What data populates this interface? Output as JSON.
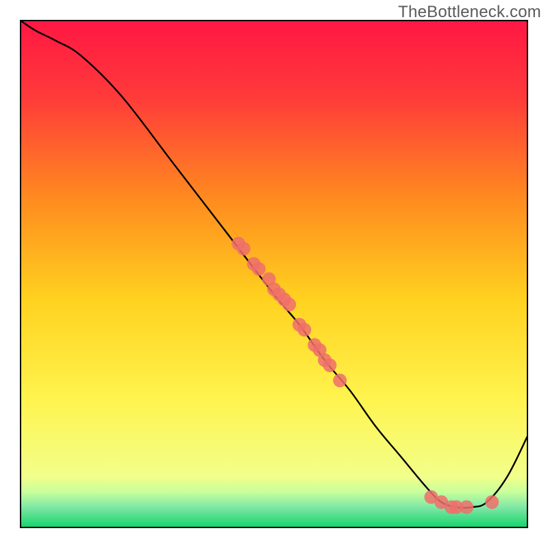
{
  "attribution": "TheBottleneck.com",
  "chart_data": {
    "type": "line",
    "title": "",
    "xlabel": "",
    "ylabel": "",
    "xlim": [
      0,
      100
    ],
    "ylim": [
      0,
      100
    ],
    "series": [
      {
        "name": "curve",
        "x": [
          0,
          3,
          7,
          12,
          20,
          30,
          40,
          50,
          55,
          60,
          65,
          70,
          75,
          80,
          83,
          86,
          89,
          92,
          96,
          100
        ],
        "y": [
          100,
          98,
          96,
          93,
          85,
          72,
          59,
          46,
          40,
          33,
          27,
          20,
          14,
          8,
          5,
          4,
          4,
          5,
          10,
          18
        ]
      }
    ],
    "markers": {
      "name": "highlight-points",
      "x": [
        43,
        44,
        46,
        47,
        49,
        50,
        51,
        52,
        53,
        55,
        56,
        58,
        59,
        60,
        61,
        63,
        81,
        83,
        85,
        86,
        88,
        93
      ],
      "y": [
        56,
        55,
        52,
        51,
        49,
        47,
        46,
        45,
        44,
        40,
        39,
        36,
        35,
        33,
        32,
        29,
        6,
        5,
        4,
        4,
        4,
        5
      ]
    },
    "background": {
      "type": "vertical-gradient",
      "stops": [
        {
          "pos": 0.0,
          "color": "#ff1744"
        },
        {
          "pos": 0.15,
          "color": "#ff3a3a"
        },
        {
          "pos": 0.35,
          "color": "#ff8a1f"
        },
        {
          "pos": 0.55,
          "color": "#ffd21f"
        },
        {
          "pos": 0.75,
          "color": "#fff44f"
        },
        {
          "pos": 0.9,
          "color": "#f2ff8a"
        },
        {
          "pos": 0.93,
          "color": "#c8ff9c"
        },
        {
          "pos": 0.96,
          "color": "#7fe8a5"
        },
        {
          "pos": 1.0,
          "color": "#14d46c"
        }
      ]
    },
    "marker_style": {
      "fill": "#ef6f6b",
      "stroke": "#ef6f6b",
      "radius": 10
    },
    "curve_style": {
      "stroke": "#000000",
      "width": 2.4
    },
    "frame_style": {
      "stroke": "#000000",
      "width": 2
    }
  }
}
